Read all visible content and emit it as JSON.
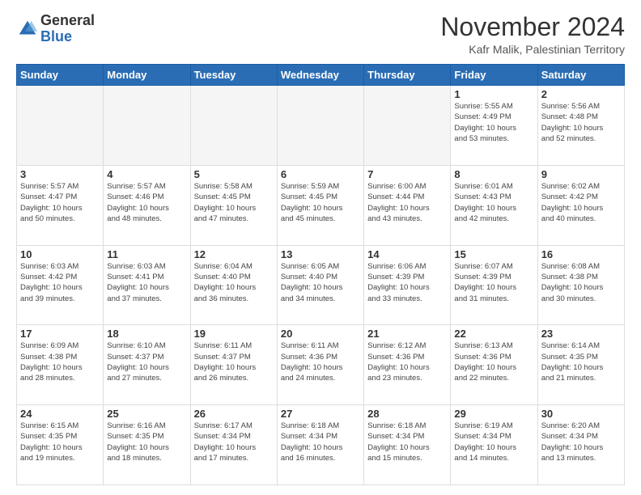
{
  "logo": {
    "general": "General",
    "blue": "Blue"
  },
  "title": "November 2024",
  "location": "Kafr Malik, Palestinian Territory",
  "days_of_week": [
    "Sunday",
    "Monday",
    "Tuesday",
    "Wednesday",
    "Thursday",
    "Friday",
    "Saturday"
  ],
  "weeks": [
    [
      {
        "day": "",
        "info": "",
        "empty": true
      },
      {
        "day": "",
        "info": "",
        "empty": true
      },
      {
        "day": "",
        "info": "",
        "empty": true
      },
      {
        "day": "",
        "info": "",
        "empty": true
      },
      {
        "day": "",
        "info": "",
        "empty": true
      },
      {
        "day": "1",
        "info": "Sunrise: 5:55 AM\nSunset: 4:49 PM\nDaylight: 10 hours\nand 53 minutes."
      },
      {
        "day": "2",
        "info": "Sunrise: 5:56 AM\nSunset: 4:48 PM\nDaylight: 10 hours\nand 52 minutes."
      }
    ],
    [
      {
        "day": "3",
        "info": "Sunrise: 5:57 AM\nSunset: 4:47 PM\nDaylight: 10 hours\nand 50 minutes."
      },
      {
        "day": "4",
        "info": "Sunrise: 5:57 AM\nSunset: 4:46 PM\nDaylight: 10 hours\nand 48 minutes."
      },
      {
        "day": "5",
        "info": "Sunrise: 5:58 AM\nSunset: 4:45 PM\nDaylight: 10 hours\nand 47 minutes."
      },
      {
        "day": "6",
        "info": "Sunrise: 5:59 AM\nSunset: 4:45 PM\nDaylight: 10 hours\nand 45 minutes."
      },
      {
        "day": "7",
        "info": "Sunrise: 6:00 AM\nSunset: 4:44 PM\nDaylight: 10 hours\nand 43 minutes."
      },
      {
        "day": "8",
        "info": "Sunrise: 6:01 AM\nSunset: 4:43 PM\nDaylight: 10 hours\nand 42 minutes."
      },
      {
        "day": "9",
        "info": "Sunrise: 6:02 AM\nSunset: 4:42 PM\nDaylight: 10 hours\nand 40 minutes."
      }
    ],
    [
      {
        "day": "10",
        "info": "Sunrise: 6:03 AM\nSunset: 4:42 PM\nDaylight: 10 hours\nand 39 minutes."
      },
      {
        "day": "11",
        "info": "Sunrise: 6:03 AM\nSunset: 4:41 PM\nDaylight: 10 hours\nand 37 minutes."
      },
      {
        "day": "12",
        "info": "Sunrise: 6:04 AM\nSunset: 4:40 PM\nDaylight: 10 hours\nand 36 minutes."
      },
      {
        "day": "13",
        "info": "Sunrise: 6:05 AM\nSunset: 4:40 PM\nDaylight: 10 hours\nand 34 minutes."
      },
      {
        "day": "14",
        "info": "Sunrise: 6:06 AM\nSunset: 4:39 PM\nDaylight: 10 hours\nand 33 minutes."
      },
      {
        "day": "15",
        "info": "Sunrise: 6:07 AM\nSunset: 4:39 PM\nDaylight: 10 hours\nand 31 minutes."
      },
      {
        "day": "16",
        "info": "Sunrise: 6:08 AM\nSunset: 4:38 PM\nDaylight: 10 hours\nand 30 minutes."
      }
    ],
    [
      {
        "day": "17",
        "info": "Sunrise: 6:09 AM\nSunset: 4:38 PM\nDaylight: 10 hours\nand 28 minutes."
      },
      {
        "day": "18",
        "info": "Sunrise: 6:10 AM\nSunset: 4:37 PM\nDaylight: 10 hours\nand 27 minutes."
      },
      {
        "day": "19",
        "info": "Sunrise: 6:11 AM\nSunset: 4:37 PM\nDaylight: 10 hours\nand 26 minutes."
      },
      {
        "day": "20",
        "info": "Sunrise: 6:11 AM\nSunset: 4:36 PM\nDaylight: 10 hours\nand 24 minutes."
      },
      {
        "day": "21",
        "info": "Sunrise: 6:12 AM\nSunset: 4:36 PM\nDaylight: 10 hours\nand 23 minutes."
      },
      {
        "day": "22",
        "info": "Sunrise: 6:13 AM\nSunset: 4:36 PM\nDaylight: 10 hours\nand 22 minutes."
      },
      {
        "day": "23",
        "info": "Sunrise: 6:14 AM\nSunset: 4:35 PM\nDaylight: 10 hours\nand 21 minutes."
      }
    ],
    [
      {
        "day": "24",
        "info": "Sunrise: 6:15 AM\nSunset: 4:35 PM\nDaylight: 10 hours\nand 19 minutes."
      },
      {
        "day": "25",
        "info": "Sunrise: 6:16 AM\nSunset: 4:35 PM\nDaylight: 10 hours\nand 18 minutes."
      },
      {
        "day": "26",
        "info": "Sunrise: 6:17 AM\nSunset: 4:34 PM\nDaylight: 10 hours\nand 17 minutes."
      },
      {
        "day": "27",
        "info": "Sunrise: 6:18 AM\nSunset: 4:34 PM\nDaylight: 10 hours\nand 16 minutes."
      },
      {
        "day": "28",
        "info": "Sunrise: 6:18 AM\nSunset: 4:34 PM\nDaylight: 10 hours\nand 15 minutes."
      },
      {
        "day": "29",
        "info": "Sunrise: 6:19 AM\nSunset: 4:34 PM\nDaylight: 10 hours\nand 14 minutes."
      },
      {
        "day": "30",
        "info": "Sunrise: 6:20 AM\nSunset: 4:34 PM\nDaylight: 10 hours\nand 13 minutes."
      }
    ]
  ]
}
